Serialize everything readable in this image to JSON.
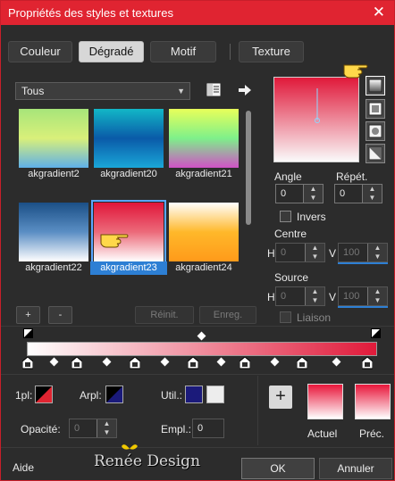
{
  "window": {
    "title": "Propriétés des styles et textures",
    "close_glyph": "✕"
  },
  "tabs": [
    {
      "label": "Couleur",
      "active": false
    },
    {
      "label": "Dégradé",
      "active": true
    },
    {
      "label": "Motif",
      "active": false
    },
    {
      "label": "Texture",
      "active": false
    }
  ],
  "library": {
    "filter_value": "Tous",
    "icons": {
      "save": "gradient-library-icon",
      "arrow": "arrow-right-icon"
    },
    "gradients": [
      {
        "name": "akgradient2",
        "stops": [
          "#a7e57a",
          "#d9f07a",
          "#5fb0e8"
        ],
        "selected": false
      },
      {
        "name": "akgradient20",
        "stops": [
          "#12b7c7",
          "#0a5aa8",
          "#1aa7d8"
        ],
        "selected": false
      },
      {
        "name": "akgradient21",
        "stops": [
          "#e8ff5a",
          "#7ef08a",
          "#d052c6"
        ],
        "selected": false
      },
      {
        "name": "akgradient22",
        "stops": [
          "#1b4f86",
          "#5a8ec4",
          "#ffffff"
        ],
        "selected": false
      },
      {
        "name": "akgradient23",
        "stops": [
          "#e0163a",
          "#ec6a7a",
          "#ffffff"
        ],
        "selected": true
      },
      {
        "name": "akgradient24",
        "stops": [
          "#ffffff",
          "#ffb82a",
          "#ff9a1a"
        ],
        "selected": false
      }
    ],
    "add_label": "+",
    "remove_label": "-",
    "reset_label": "Réinit.",
    "save_label": "Enreg."
  },
  "style": {
    "angle_label": "Angle",
    "angle_value": "0",
    "repeat_label": "Répét.",
    "repeat_value": "0",
    "invert_label": "Invers",
    "center_label": "Centre",
    "center_h_label": "H",
    "center_h_value": "0",
    "center_v_label": "V",
    "center_v_value": "100",
    "source_label": "Source",
    "source_h_label": "H",
    "source_h_value": "0",
    "source_v_label": "V",
    "source_v_value": "100",
    "link_label": "Liaison",
    "types": [
      "linear-gradient-icon",
      "rectangular-gradient-icon",
      "sunburst-gradient-icon",
      "radial-gradient-icon"
    ]
  },
  "editor": {
    "fg_label": "1pl:",
    "bg_label": "Arpl:",
    "user_label": "Util.:",
    "user_color": "#1b1a7a",
    "opacity_label": "Opacité:",
    "opacity_value": "0",
    "location_label": "Empl.:",
    "location_value": "0"
  },
  "materials": {
    "current_label": "Actuel",
    "previous_label": "Préc.",
    "add_label": "+"
  },
  "footer": {
    "help_label": "Aide",
    "brand": "Renée Design",
    "ok_label": "OK",
    "cancel_label": "Annuler"
  },
  "colors": {
    "accent": "#e02431",
    "selection": "#2d7fd4"
  }
}
